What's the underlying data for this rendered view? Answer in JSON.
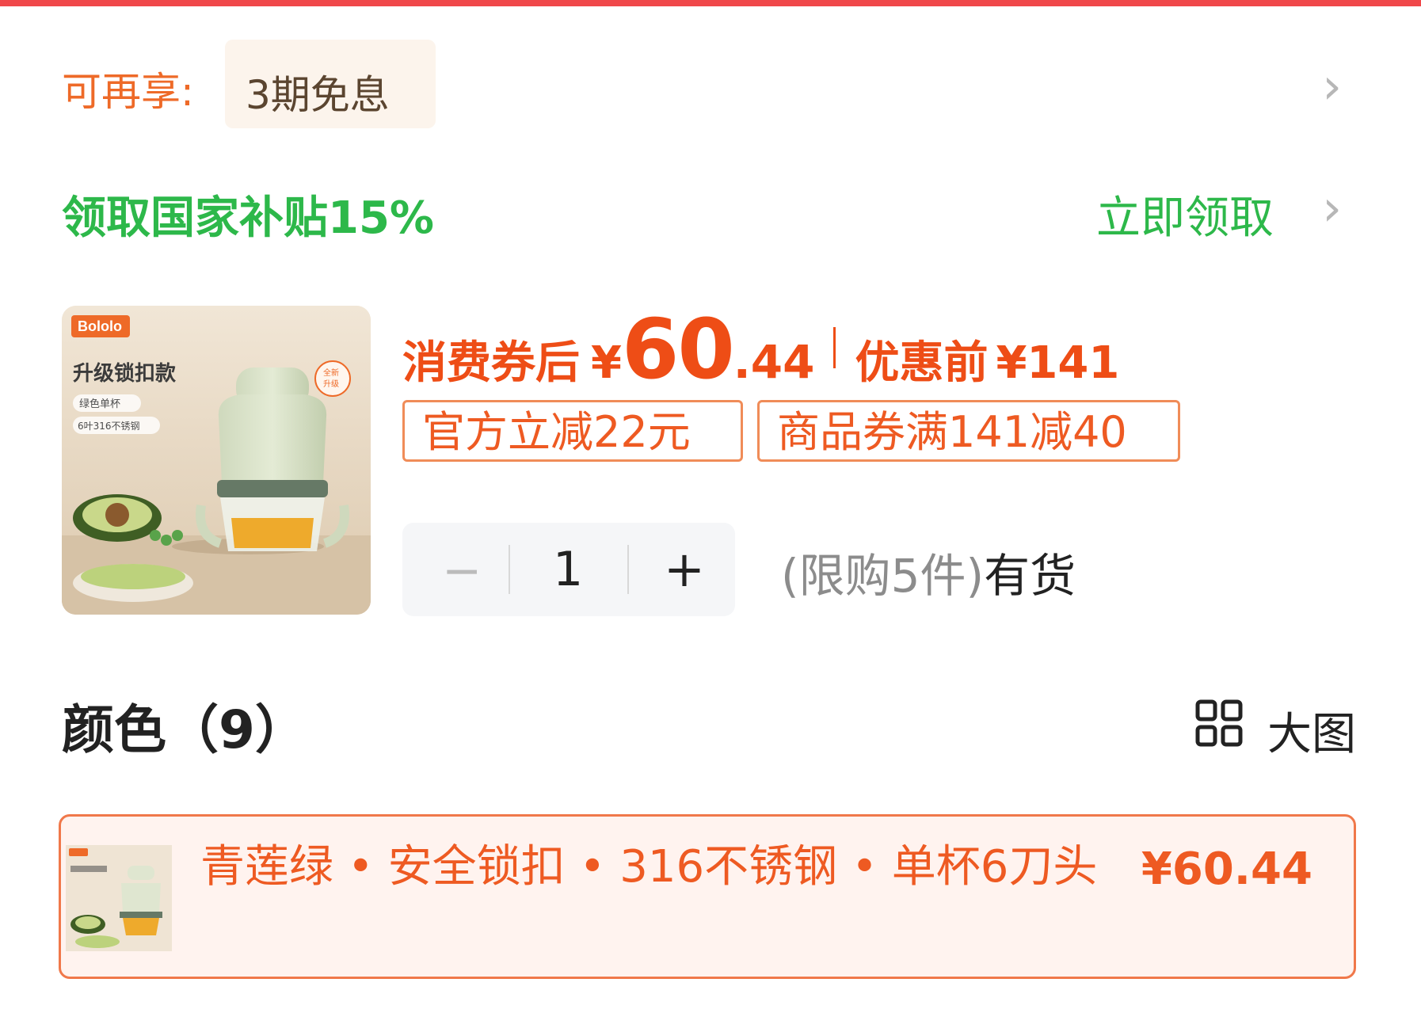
{
  "installment": {
    "label": "可再享:",
    "badge": "3期免息"
  },
  "subsidy": {
    "text": "领取国家补贴15%",
    "action": "立即领取"
  },
  "product": {
    "brand": "Bololo",
    "promo_title": "升级锁扣款",
    "promo_sub1": "绿色单杯",
    "promo_sub2": "6叶316不锈钢",
    "badge_line1": "全新",
    "badge_line2": "升级",
    "after_coupon_label": "消费券后",
    "currency": "¥",
    "price_int": "60",
    "price_dec": ".44",
    "before_label": "优惠前",
    "before_price": "¥141",
    "tags": [
      "官方立减22元",
      "商品券满141减40"
    ]
  },
  "quantity": {
    "minus": "−",
    "value": "1",
    "plus": "+"
  },
  "stock": {
    "limit": "(限购5件)",
    "status": "有货"
  },
  "color_section": {
    "title": "颜色（9）",
    "big_view": "大图"
  },
  "selected_sku": {
    "name": "青莲绿 • 安全锁扣 • 316不锈钢 • 单杯6刀头",
    "price": "¥60.44"
  },
  "icons": {
    "chevron": "chevron-right-icon",
    "grid": "grid-view-icon"
  },
  "colors": {
    "orange": "#ee4d16",
    "green": "#2db84a",
    "topbar": "#f0484a"
  }
}
